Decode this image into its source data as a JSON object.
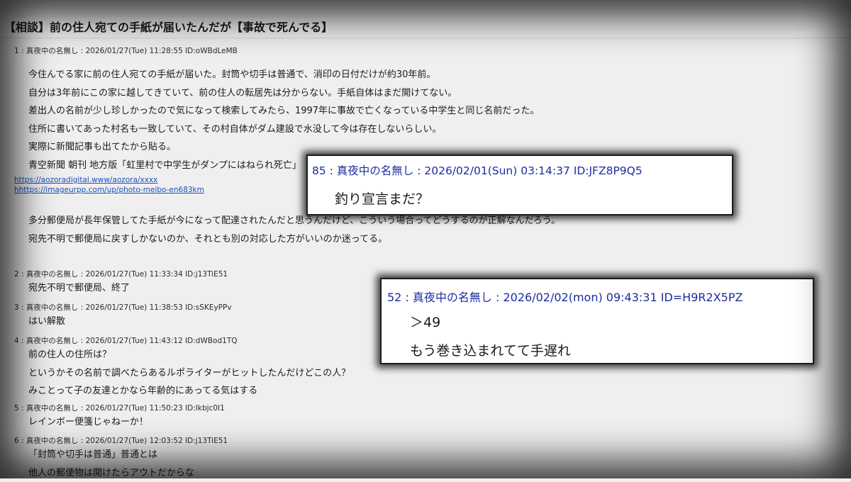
{
  "thread_title": "【相談】前の住人宛ての手紙が届いたんだが【事故で死んでる】",
  "posts": [
    {
      "header": "1 : 真夜中の名無し : 2026/01/27(Tue) 11:28:55 ID:oWBdLeMB",
      "lines": [
        "今住んでる家に前の住人宛ての手紙が届いた。封筒や切手は普通で、消印の日付だけが約30年前。",
        "自分は3年前にこの家に越してきていて、前の住人の転居先は分からない。手紙自体はまだ開けてない。",
        "差出人の名前が少し珍しかったので気になって検索してみたら、1997年に事故で亡くなっている中学生と同じ名前だった。",
        "住所に書いてあった村名も一致していて、その村自体がダム建設で水没して今は存在しないらしい。",
        "実際に新聞記事も出てたから貼る。",
        "青空新聞 朝刊 地方版「虹里村で中学生がダンプにはねられ死亡」"
      ],
      "links": [
        "https://aozoradigital.www/aozora/xxxx",
        "hhttps://imageurpp.com/up/photo-meibo-en683km"
      ],
      "lines_after": [
        "多分郵便局が長年保管してた手紙が今になって配達されたんだと思うんだけど、こういう場合ってどうするのが正解なんだろう。",
        "宛先不明で郵便局に戻すしかないのか、それとも別の対応した方がいいのか迷ってる。"
      ]
    },
    {
      "header": "2 : 真夜中の名無し : 2026/01/27(Tue) 11:33:34 ID:j13TiE51",
      "lines": [
        "宛先不明で郵便局、終了"
      ]
    },
    {
      "header": "3 : 真夜中の名無し : 2026/01/27(Tue) 11:38:53 ID:sSKEyPPv",
      "lines": [
        "はい解散"
      ]
    },
    {
      "header": "4 : 真夜中の名無し : 2026/01/27(Tue) 11:43:12 ID:dWBod1TQ",
      "lines": [
        "前の住人の住所は？",
        "というかその名前で調べたらあるルポライターがヒットしたんだけどこの人？",
        "みことって子の友達とかなら年齢的にあってる気はする"
      ]
    },
    {
      "header": "5 : 真夜中の名無し : 2026/01/27(Tue) 11:50:23 ID:Ikbjc0I1",
      "lines": [
        "レインボー便箋じゃねーか！"
      ]
    },
    {
      "header": "6 : 真夜中の名無し : 2026/01/27(Tue) 12:03:52 ID:j13TiE51",
      "lines": [
        "「封筒や切手は普通」普通とは",
        "他人の郵便物は開けたらアウトだからな"
      ]
    }
  ],
  "overlays": [
    {
      "header": "85 : 真夜中の名無し : 2026/02/01(Sun) 03:14:37 ID:JFZ8P9Q5",
      "lines": [
        "釣り宣言まだ？"
      ]
    },
    {
      "header": "52 : 真夜中の名無し : 2026/02/02(mon) 09:43:31 ID=H9R2X5PZ",
      "lines": [
        "＞49",
        "もう巻き込まれてて手遅れ"
      ]
    }
  ]
}
